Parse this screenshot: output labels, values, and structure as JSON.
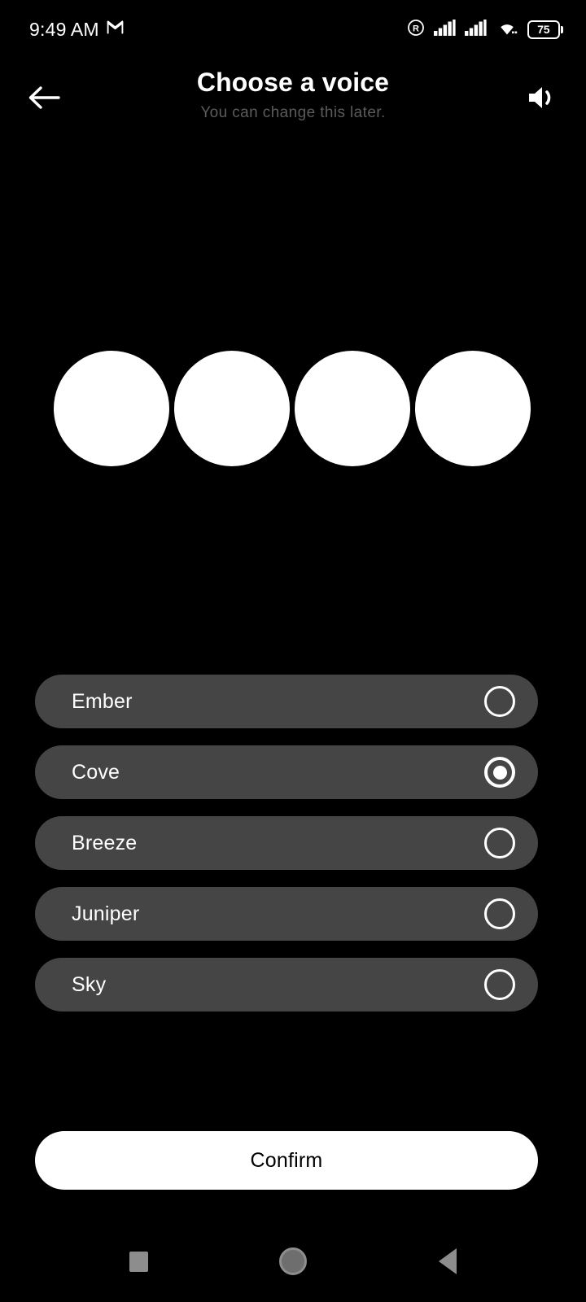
{
  "status_bar": {
    "time": "9:49 AM",
    "gmail_icon": "gmail-icon",
    "roaming_icon": "roaming-r-icon",
    "signal_icon_1": "signal-bars-icon",
    "signal_icon_2": "signal-bars-icon",
    "wifi_icon": "wifi-icon",
    "battery_level": "75"
  },
  "header": {
    "back_icon": "back-arrow-icon",
    "title": "Choose a voice",
    "subtitle": "You can change this later.",
    "speaker_icon": "speaker-volume-icon"
  },
  "visualizer": {
    "orb_count": 4,
    "orb_color": "#ffffff"
  },
  "voice_list": {
    "selected": "Cove",
    "items": [
      {
        "label": "Ember",
        "selected": false
      },
      {
        "label": "Cove",
        "selected": true
      },
      {
        "label": "Breeze",
        "selected": false
      },
      {
        "label": "Juniper",
        "selected": false
      },
      {
        "label": "Sky",
        "selected": false
      }
    ]
  },
  "footer": {
    "confirm_label": "Confirm"
  },
  "nav_bar": {
    "recents_icon": "square-recents-icon",
    "home_icon": "circle-home-icon",
    "back_icon": "triangle-back-icon"
  },
  "colors": {
    "background": "#000000",
    "item_background": "#454545",
    "accent": "#ffffff",
    "subtitle": "#5b5b5b",
    "nav_icon": "#8d8d8d"
  }
}
